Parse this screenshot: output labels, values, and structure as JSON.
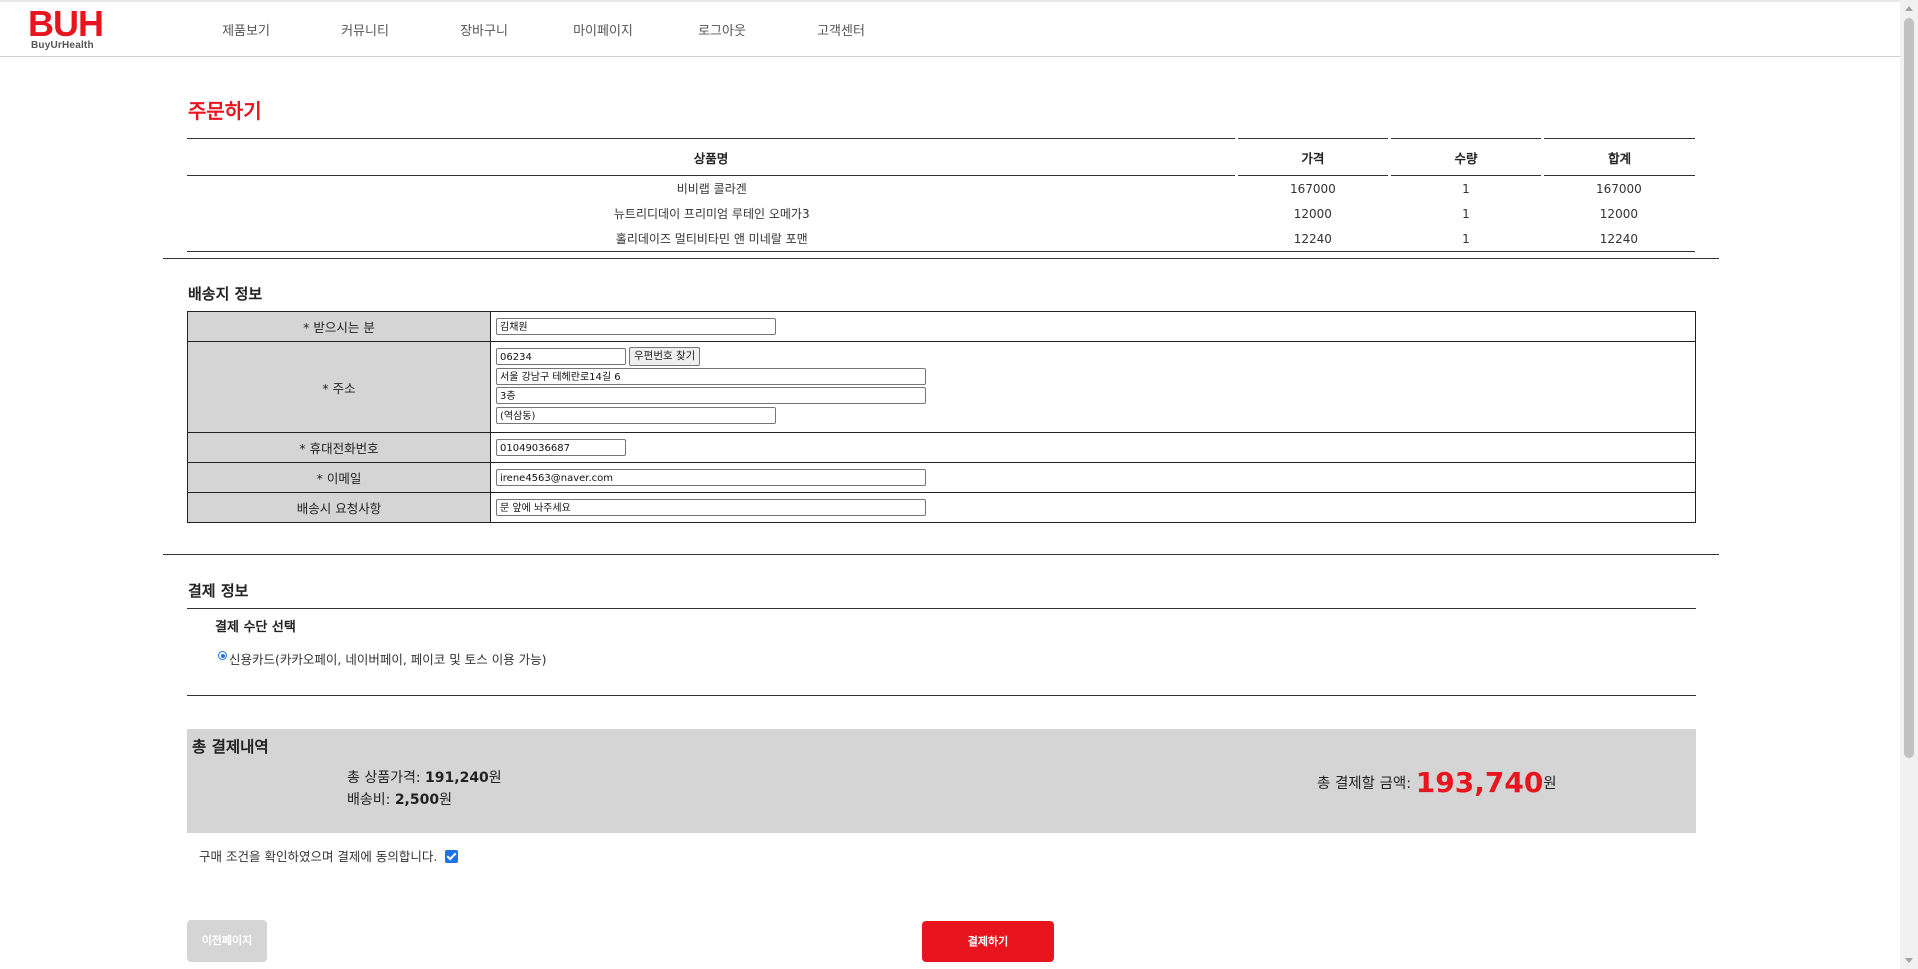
{
  "header": {
    "logo_main": "BUH",
    "logo_sub": "BuyUrHealth",
    "nav": [
      "제품보기",
      "커뮤니티",
      "장바구니",
      "마이페이지",
      "로그아웃",
      "고객센터"
    ]
  },
  "page_title": "주문하기",
  "order": {
    "headers": [
      "상품명",
      "가격",
      "수량",
      "합계"
    ],
    "rows": [
      [
        "비비랩 콜라겐",
        "167000",
        "1",
        "167000"
      ],
      [
        "뉴트리디데이 프리미엄 루테인 오메가3",
        "12000",
        "1",
        "12000"
      ],
      [
        "홀리데이즈 멀티비타민 앤 미네랄 포맨",
        "12240",
        "1",
        "12240"
      ]
    ]
  },
  "shipping": {
    "title": "배송지 정보",
    "recipient_label": "* 받으시는 분",
    "recipient_value": "김채원",
    "address_label": "* 주소",
    "zip_value": "06234",
    "zip_button": "우편번호 찾기",
    "address1_value": "서울 강남구 테헤란로14길 6",
    "address2_value": "3층",
    "address3_value": " (역삼동)",
    "phone_label": "* 휴대전화번호",
    "phone_value": "01049036687",
    "email_label": "* 이메일",
    "email_value": "irene4563@naver.com",
    "request_label": "배송시 요청사항",
    "request_value": "문 앞에 놔주세요"
  },
  "payment": {
    "title": "결제 정보",
    "method_title": "결제 수단 선택",
    "method_option": "신용카드(카카오페이, 네이버페이, 페이코 및 토스 이용 가능)"
  },
  "summary": {
    "title": "총 결제내역",
    "product_label": "총 상품가격: ",
    "product_value": "191,240",
    "shipping_label": "배송비: ",
    "shipping_value": "2,500",
    "won": "원",
    "total_label": "총 결제할 금액: ",
    "total_value": "193,740"
  },
  "agree_text": "구매 조건을 확인하였으며 결제에 동의합니다.",
  "buttons": {
    "prev": "이전페이지",
    "pay": "결제하기"
  },
  "colors": {
    "accent": "#e8141e",
    "panel": "#d5d5d5"
  }
}
